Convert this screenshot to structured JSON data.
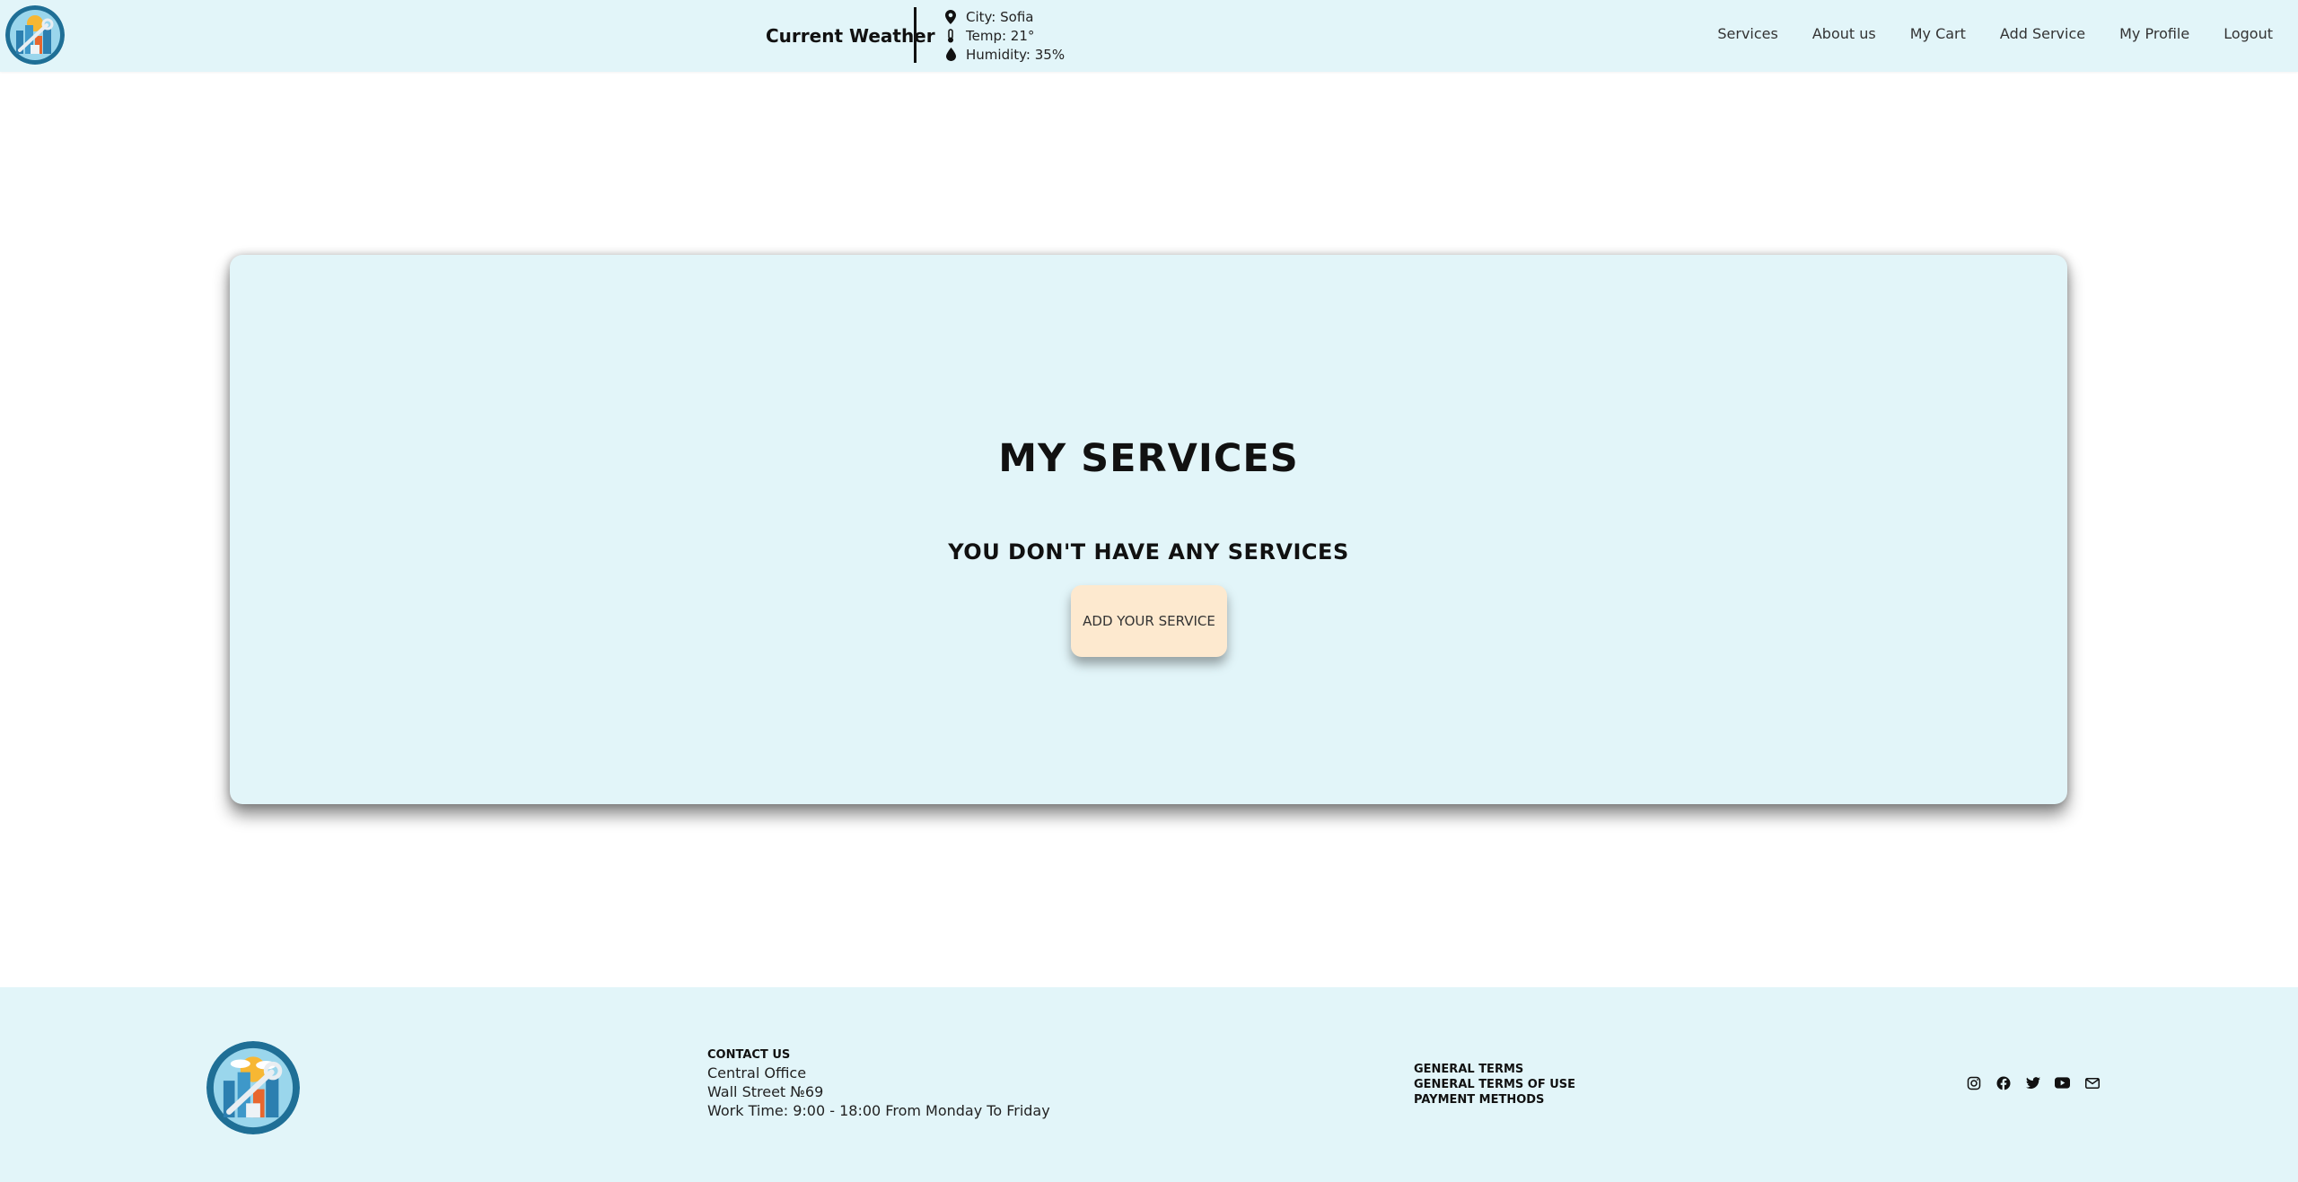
{
  "header": {
    "weather_title": "Current Weather",
    "weather": {
      "city": "City: Sofia",
      "temp": "Temp: 21°",
      "humidity": "Humidity: 35%"
    },
    "nav": [
      "Services",
      "About us",
      "My Cart",
      "Add Service",
      "My Profile",
      "Logout"
    ]
  },
  "main": {
    "title": "MY SERVICES",
    "empty_message": "YOU DON'T HAVE ANY SERVICES",
    "add_button": "ADD YOUR SERVICE"
  },
  "footer": {
    "contact_heading": "CONTACT US",
    "contact_lines": [
      "Central Office",
      "Wall Street №69",
      "Work Time: 9:00 - 18:00 From Monday To Friday"
    ],
    "terms": [
      "GENERAL TERMS",
      "GENERAL TERMS OF USE",
      "PAYMENT METHODS"
    ],
    "social_icons": [
      "instagram-icon",
      "facebook-icon",
      "twitter-icon",
      "youtube-icon",
      "mail-icon"
    ]
  },
  "colors": {
    "header_bg": "#e2f5f9",
    "card_bg": "#e2f5f9",
    "button_bg": "#fde9cf"
  }
}
